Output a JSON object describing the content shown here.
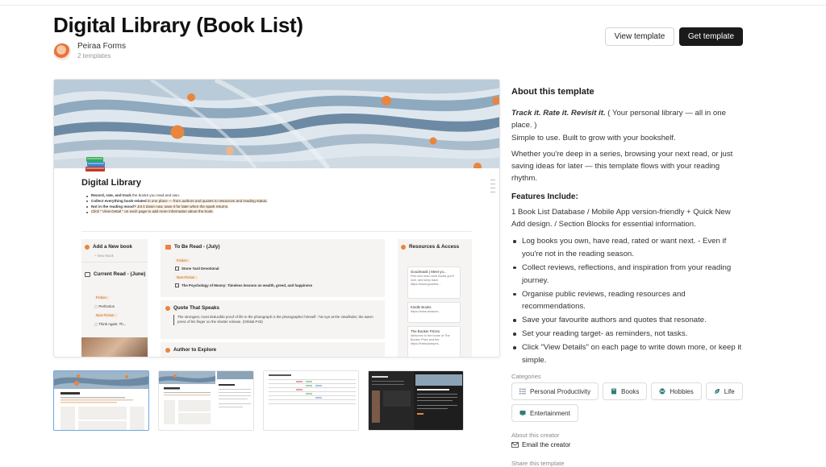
{
  "page": {
    "title": "Digital Library (Book List)",
    "creator_name": "Peiraa Forms",
    "creator_sub": "2 templates",
    "view_button": "View template",
    "get_button": "Get template"
  },
  "preview": {
    "title": "Digital Library",
    "bullets": [
      {
        "bold": "Record, rate, and track",
        "rest": " the books you read and own."
      },
      {
        "bold": "Collect everything book-related",
        "rest": " in one place — from authors and quotes to resources and reading status."
      },
      {
        "bold": "Not in the reading mood?",
        "rest": " Jot it down now, save it for later when the spark returns."
      },
      {
        "bold": "",
        "rest": "Click \" View Detail \" on each page to add more information about the book."
      }
    ],
    "left": {
      "add_new": "Add a New book",
      "new_book": "New Book",
      "current_read": "Current Read - (June)",
      "fiction": "Fiction :",
      "fiction_item": "Perfection",
      "nonfiction": "Non-Fiction :",
      "nonfiction_item": "Think Again: Th..."
    },
    "mid": {
      "to_be_read": "To Be Read - (July)",
      "fiction": "Fiction :",
      "fiction_item": "Stone Yard Devotional",
      "nonfiction": "Non-Fiction :",
      "nonfiction_item": "The Psychology of Money: Timeless lessons on wealth, greed, and happiness",
      "quote_h": "Quote That Speaks",
      "quote": "The strongest, most deducible proof of life in the photograph is the photographer himself - his eye at the viewfinder, the warm press of his finger on the shutter release. (Orbital P43)",
      "author_h": "Author to Explore"
    },
    "right": {
      "heading": "Resources & Access",
      "cards": [
        {
          "title": "Goodreads | Meet yo...",
          "sub": "Find and read more books you'll love, and keep track",
          "link": "https://www.goodrea..."
        },
        {
          "title": "Kindle Books",
          "sub": "",
          "link": "https://www.amazon...."
        },
        {
          "title": "The Booker Prizes",
          "sub": "Welcome to the home of The Booker Prize and the",
          "link": "https://thebookerpriz..."
        }
      ]
    }
  },
  "side": {
    "about_heading": "About this template",
    "tagline": "Track it. Rate it. Revisit it.",
    "tagline_rest": " ( Your personal library — all in one place. )",
    "line2": "Simple to use. Built to grow with your bookshelf.",
    "para2": "Whether you're deep in a series, browsing your next read, or just saving ideas for later — this template flows with your reading rhythm.",
    "features_heading": "Features Include:",
    "features_intro": "1 Book List Database / Mobile App version-friendly + Quick New Add design. / Section Blocks for essential information.",
    "features": [
      "Log books you own, have read, rated or want next. - Even if you're not in the reading season.",
      "Collect reviews, reflections, and inspiration from your reading journey.",
      "Organise public reviews, reading resources and recommendations.",
      "Save your favourite authors and quotes that resonate.",
      "Set your reading target- as reminders, not tasks.",
      "Click \"View Details\" on each page to write down more, or keep it simple."
    ],
    "categories_heading": "Categories",
    "categories": [
      {
        "label": "Personal Productivity",
        "icon": "checklist-icon",
        "color": "#6b7c8f"
      },
      {
        "label": "Books",
        "icon": "book-icon",
        "color": "#2e7d78"
      },
      {
        "label": "Hobbies",
        "icon": "ball-icon",
        "color": "#2e7d78"
      },
      {
        "label": "Life",
        "icon": "leaf-icon",
        "color": "#2e7d78"
      },
      {
        "label": "Entertainment",
        "icon": "tv-icon",
        "color": "#2e7d78"
      }
    ],
    "about_creator_heading": "About this creator",
    "email_creator": "Email the creator",
    "share_heading": "Share this template"
  },
  "colors": {
    "accent_orange": "#e9853e",
    "dark_button": "#1a1a1a",
    "thumb_active_border": "#6fa6e4"
  }
}
